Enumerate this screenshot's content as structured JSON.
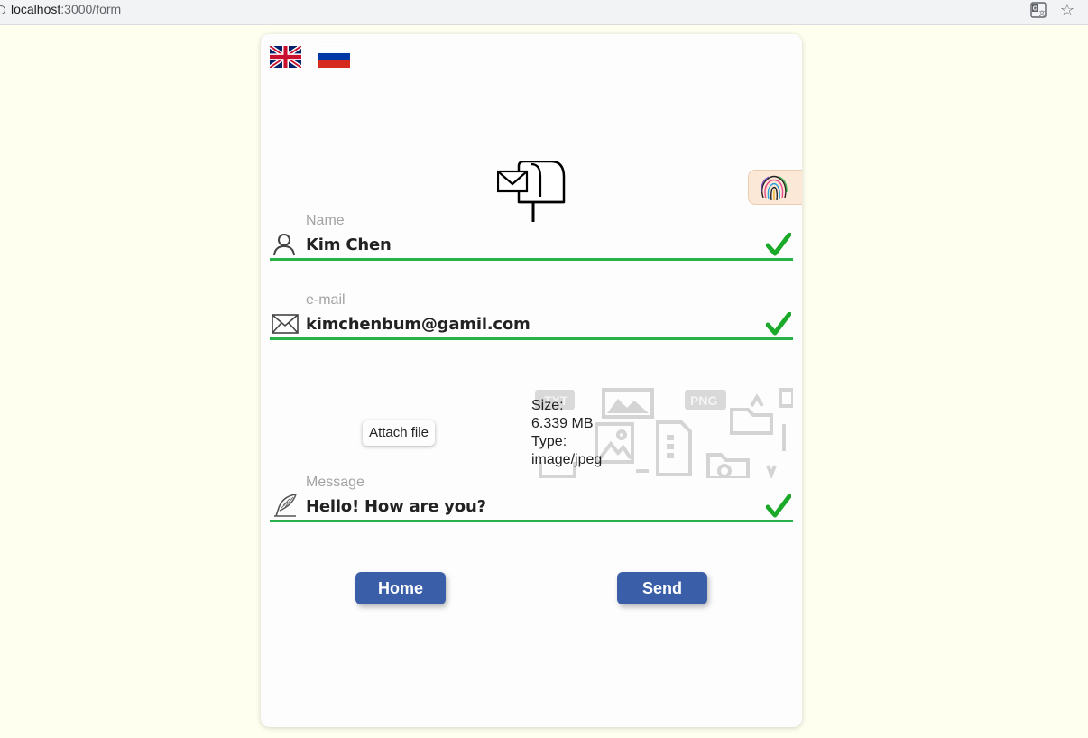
{
  "browser": {
    "url_host": "localhost",
    "url_path": ":3000/form",
    "translate_icon": "translate-icon",
    "bookmark_icon": "star-icon"
  },
  "languages": [
    {
      "code": "en",
      "icon": "uk-flag-icon"
    },
    {
      "code": "ru",
      "icon": "russia-flag-icon"
    }
  ],
  "form": {
    "name": {
      "label": "Name",
      "value": "Kim Chen",
      "icon": "user-icon",
      "valid": true
    },
    "email": {
      "label": "e-mail",
      "value": "kimchenbum@gamil.com",
      "icon": "envelope-icon",
      "valid": true
    },
    "attach": {
      "button_label": "Attach file",
      "size_label": "Size:",
      "size_value": "6.339 MB",
      "type_label": "Type:",
      "type_value": "image/jpeg"
    },
    "message": {
      "label": "Message",
      "value": "Hello! How are you?",
      "icon": "quill-icon",
      "valid": true
    }
  },
  "buttons": {
    "home": "Home",
    "send": "Send"
  },
  "colors": {
    "page_bg": "#fffff0",
    "valid_line": "#28b34a",
    "check": "#1aa928",
    "button_bg": "#3b5ea8"
  }
}
